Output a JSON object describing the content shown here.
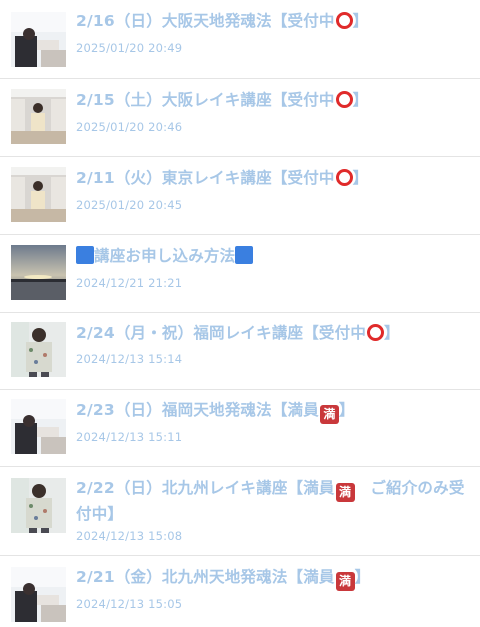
{
  "posts": [
    {
      "title": "2/16（日）大阪天地発魂法【受付中",
      "badge": "circle-icon",
      "date": "2025/01/20 20:49"
    },
    {
      "title": "2/15（土）大阪レイキ講座【受付中",
      "badge": "circle-icon",
      "date": "2025/01/20 20:46"
    },
    {
      "title": "2/11（火）東京レイキ講座【受付中",
      "badge": "circle-icon",
      "date": "2025/01/20 20:45"
    },
    {
      "title": "講座お申し込み方法",
      "badge": "blue-square-icon",
      "date": "2024/12/21 21:21"
    },
    {
      "title": "2/24（月・祝）福岡レイキ講座【受付中",
      "badge": "circle-icon",
      "date": "2024/12/13 15:14"
    },
    {
      "title": "2/23（日）福岡天地発魂法【満員",
      "badge": "full-icon",
      "badge_text": "満",
      "date": "2024/12/13 15:11"
    },
    {
      "title": "2/22（日）北九州レイキ講座【満員",
      "badge": "full-icon",
      "badge_text": "満",
      "title_tail": "　ご紹介のみ受付中】",
      "date": "2024/12/13 15:08"
    },
    {
      "title": "2/21（金）北九州天地発魂法【満員",
      "badge": "full-icon",
      "badge_text": "満",
      "date": "2024/12/13 15:05"
    }
  ],
  "closing_bracket": "】",
  "colors": {
    "link": "#a7c7e7",
    "circle": "#e02a2a",
    "full_badge": "#c9383b",
    "blue_square": "#3a7fe0"
  }
}
